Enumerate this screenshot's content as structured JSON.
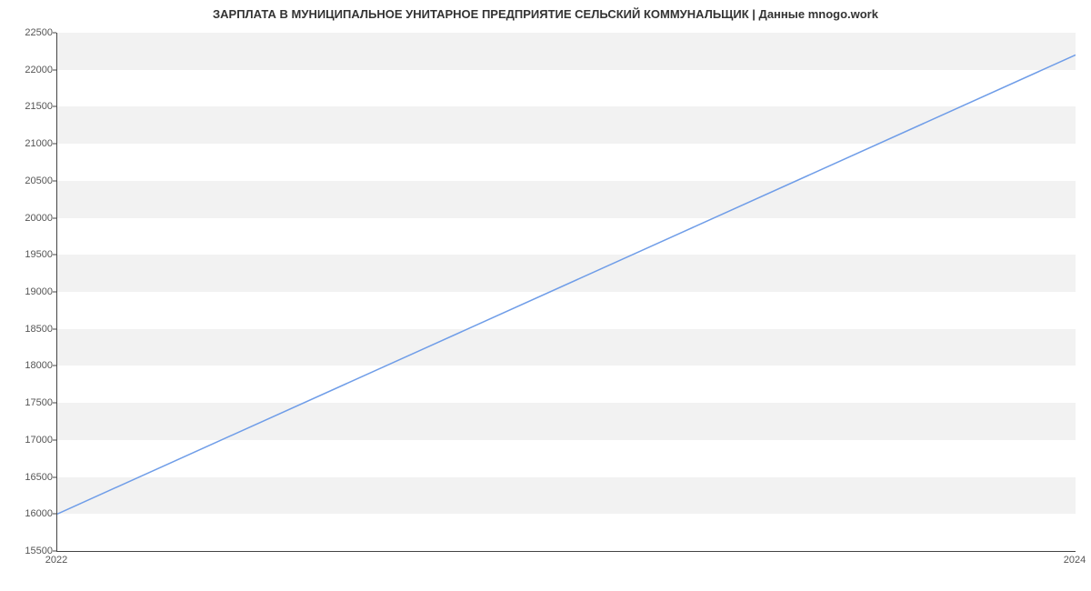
{
  "chart_data": {
    "type": "line",
    "title": "ЗАРПЛАТА В МУНИЦИПАЛЬНОЕ УНИТАРНОЕ ПРЕДПРИЯТИЕ СЕЛЬСКИЙ КОММУНАЛЬЩИК | Данные mnogo.work",
    "xlabel": "",
    "ylabel": "",
    "x": [
      2022,
      2024
    ],
    "values": [
      16000,
      22200
    ],
    "x_ticks": [
      2022,
      2024
    ],
    "y_ticks": [
      15500,
      16000,
      16500,
      17000,
      17500,
      18000,
      18500,
      19000,
      19500,
      20000,
      20500,
      21000,
      21500,
      22000,
      22500
    ],
    "xlim": [
      2022,
      2024
    ],
    "ylim": [
      15500,
      22500
    ],
    "line_color": "#6f9de8",
    "grid_bands": true
  }
}
